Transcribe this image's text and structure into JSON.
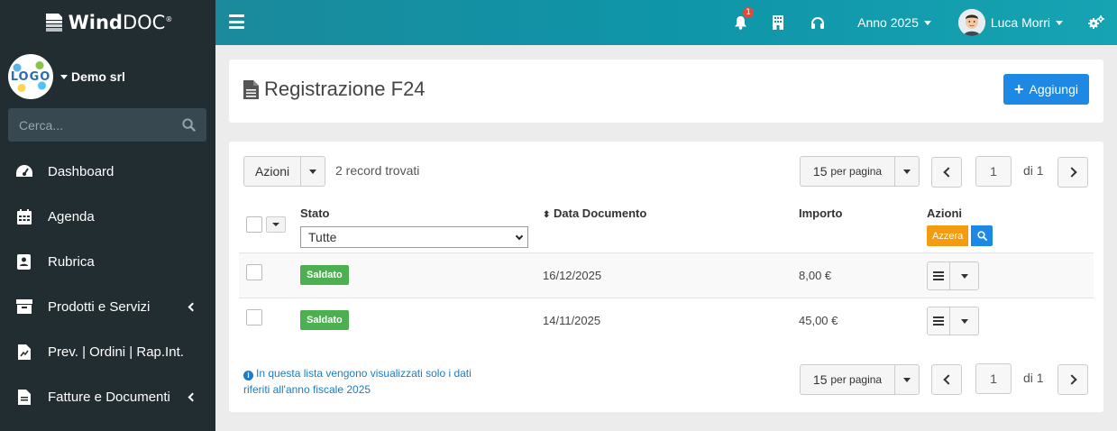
{
  "brand": {
    "name_bold": "Wind",
    "name_thin": "DOC",
    "reg": "®"
  },
  "company": {
    "logo_text": "LOGO",
    "name": "Demo srl"
  },
  "sidebar": {
    "search_placeholder": "Cerca...",
    "items": [
      {
        "label": "Dashboard",
        "icon": "dashboard-icon",
        "has_submenu": false
      },
      {
        "label": "Agenda",
        "icon": "calendar-icon",
        "has_submenu": false
      },
      {
        "label": "Rubrica",
        "icon": "contacts-icon",
        "has_submenu": false
      },
      {
        "label": "Prodotti e Servizi",
        "icon": "box-icon",
        "has_submenu": true
      },
      {
        "label": "Prev. | Ordini | Rap.Int.",
        "icon": "file-chart-icon",
        "has_submenu": false
      },
      {
        "label": "Fatture e Documenti",
        "icon": "document-icon",
        "has_submenu": true
      }
    ]
  },
  "topbar": {
    "notifications_count": "1",
    "year": "Anno 2025",
    "user": "Luca Morri"
  },
  "header": {
    "title": "Registrazione F24",
    "add_label": "Aggiungi"
  },
  "toolbar": {
    "actions_label": "Azioni",
    "records_found": "2 record trovati",
    "per_page_num": "15",
    "per_page_text": "per pagina",
    "page": "1",
    "of_pages": "di 1"
  },
  "table": {
    "columns": {
      "status": "Stato",
      "date": "Data Documento",
      "amount": "Importo",
      "actions": "Azioni"
    },
    "status_filter": "Tutte",
    "reset_label": "Azzera",
    "rows": [
      {
        "status": "Saldato",
        "date": "16/12/2025",
        "amount": "8,00 €"
      },
      {
        "status": "Saldato",
        "date": "14/11/2025",
        "amount": "45,00 €"
      }
    ]
  },
  "footer": {
    "note": "In questa lista vengono visualizzati solo i dati riferiti all'anno fiscale 2025"
  },
  "colors": {
    "sidebar_bg": "#222d32",
    "topbar": "#0f95a8",
    "primary": "#1e88e5",
    "success": "#4caf50",
    "warning": "#f39c12",
    "danger": "#dd4b39"
  }
}
